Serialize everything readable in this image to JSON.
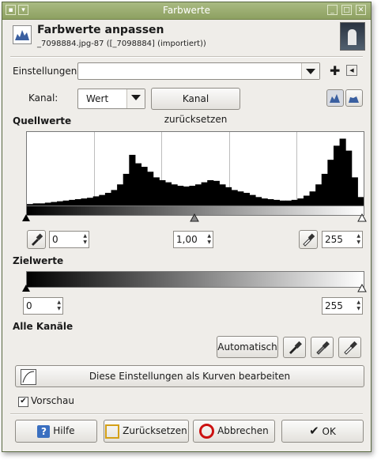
{
  "window": {
    "title": "Farbwerte"
  },
  "header": {
    "title": "Farbwerte anpassen",
    "subtitle": "_7098884.jpg-87 ([_7098884] (importiert))"
  },
  "settings": {
    "label": "Einstellungen:",
    "value": ""
  },
  "channel": {
    "label": "Kanal:",
    "value": "Wert",
    "reset_label": "Kanal zurücksetzen"
  },
  "source": {
    "heading": "Quellwerte",
    "low": "0",
    "gamma": "1,00",
    "high": "255"
  },
  "target": {
    "heading": "Zielwerte",
    "low": "0",
    "high": "255"
  },
  "all_channels": {
    "heading": "Alle Kanäle",
    "auto_label": "Automatisch"
  },
  "curves_button": "Diese Einstellungen als Kurven bearbeiten",
  "preview": {
    "label": "Vorschau",
    "checked": true
  },
  "buttons": {
    "help": "Hilfe",
    "reset": "Zurücksetzen",
    "cancel": "Abbrechen",
    "ok": "OK"
  },
  "histogram": {
    "channel": "Wert",
    "scale": "linear",
    "grid_lines": 4,
    "levels": [
      0.02,
      0.03,
      0.03,
      0.04,
      0.05,
      0.06,
      0.07,
      0.08,
      0.09,
      0.1,
      0.11,
      0.13,
      0.15,
      0.18,
      0.22,
      0.3,
      0.45,
      0.72,
      0.6,
      0.55,
      0.48,
      0.4,
      0.36,
      0.33,
      0.3,
      0.28,
      0.27,
      0.28,
      0.3,
      0.33,
      0.36,
      0.35,
      0.3,
      0.26,
      0.22,
      0.2,
      0.18,
      0.15,
      0.12,
      0.1,
      0.09,
      0.08,
      0.07,
      0.07,
      0.08,
      0.1,
      0.14,
      0.2,
      0.3,
      0.45,
      0.65,
      0.85,
      0.95,
      0.78,
      0.4,
      0.12
    ]
  }
}
